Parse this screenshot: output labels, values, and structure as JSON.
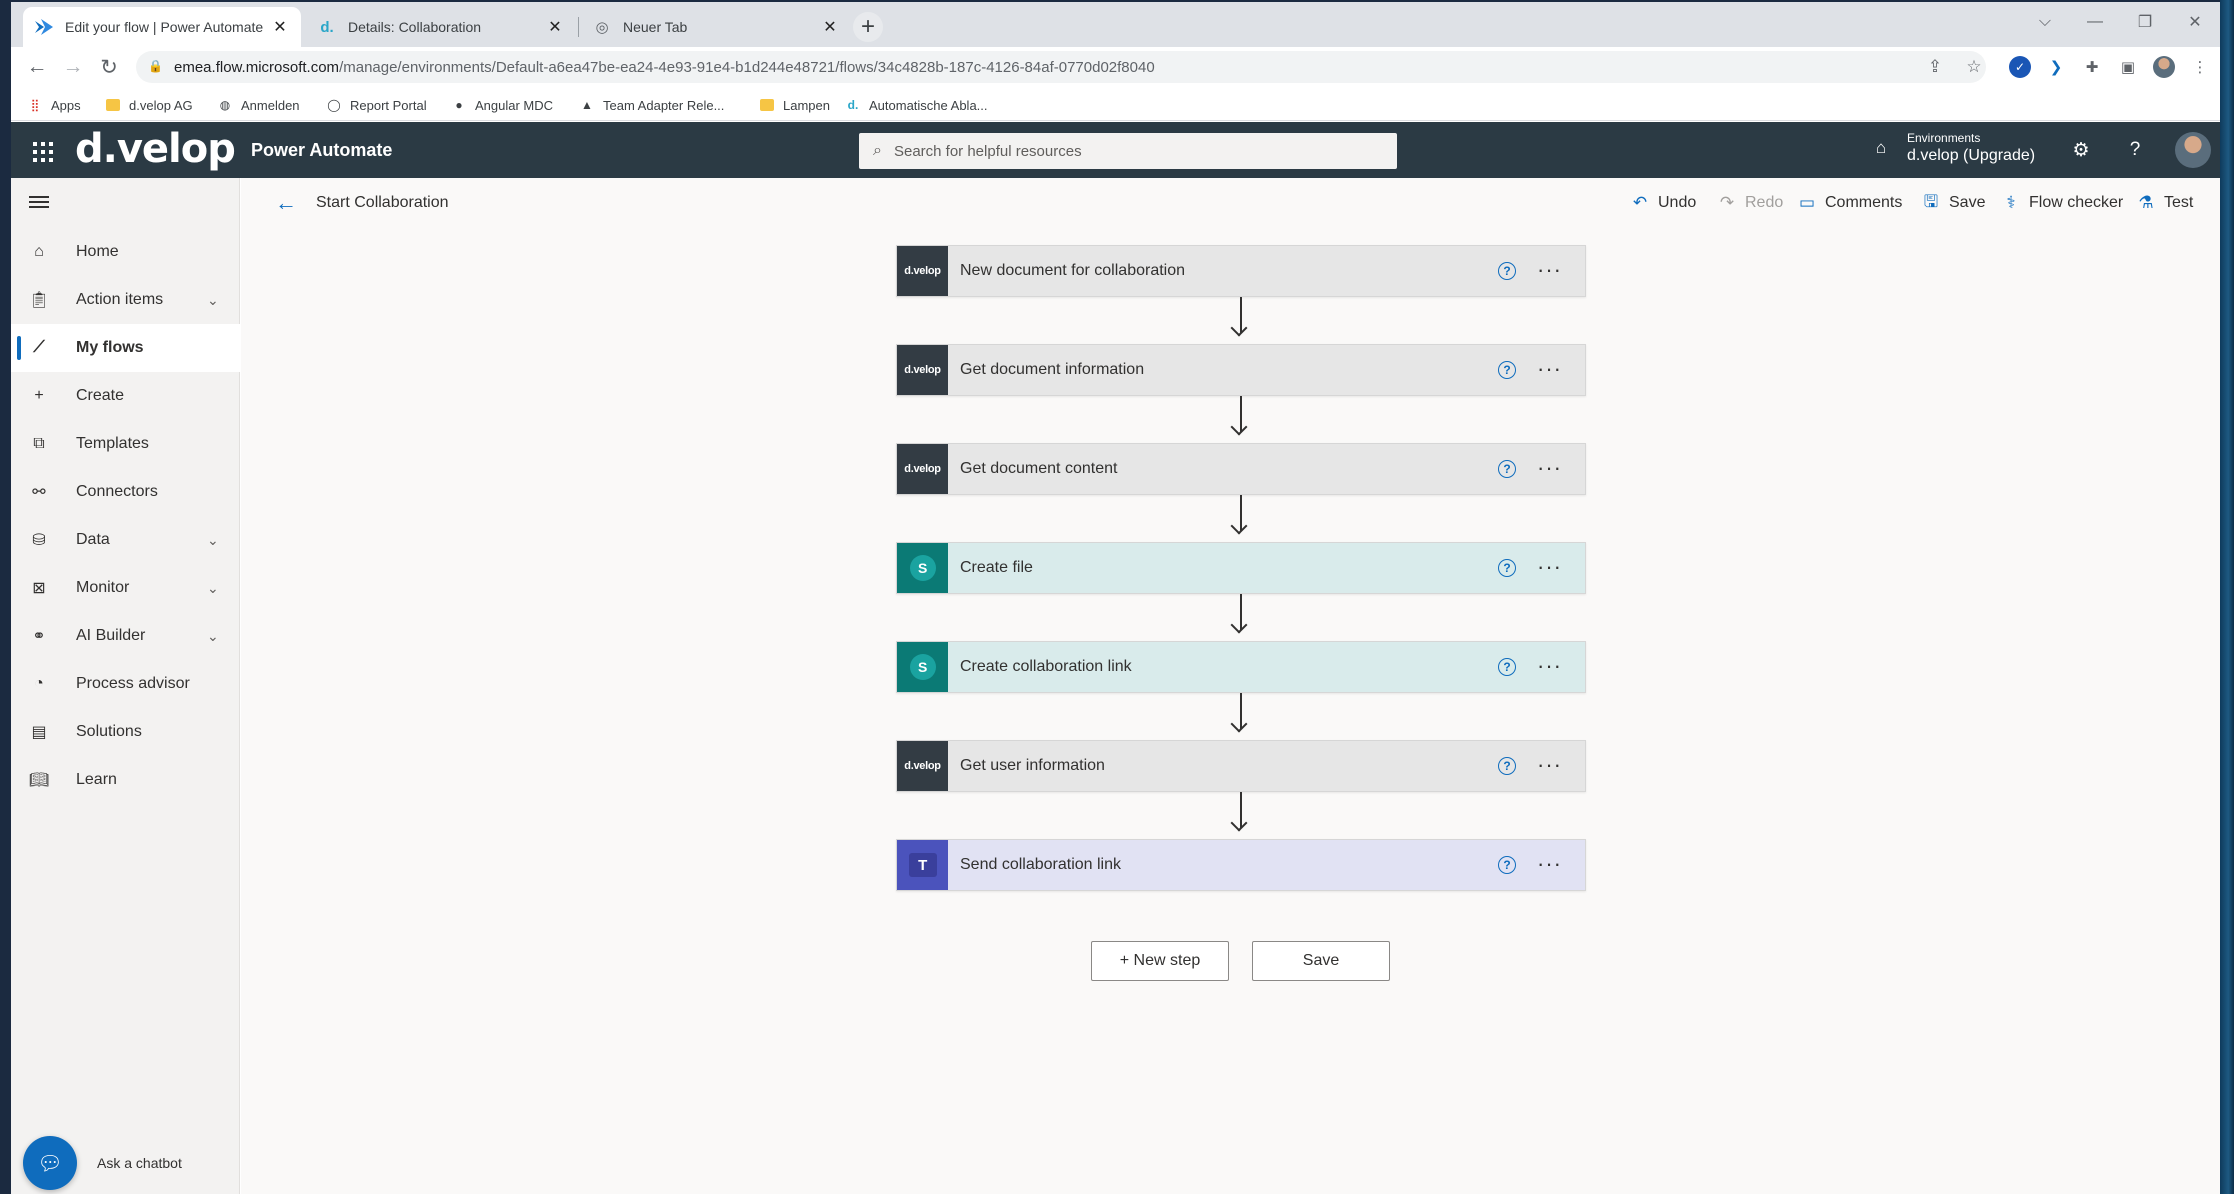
{
  "browser": {
    "tabs": [
      {
        "label": "Edit your flow | Power Automate",
        "icon": "power-automate-icon"
      },
      {
        "label": "Details: Collaboration",
        "icon": "dvelop-d-icon"
      },
      {
        "label": "Neuer Tab",
        "icon": "chrome-icon"
      }
    ],
    "url_host": "emea.flow.microsoft.com",
    "url_path": "/manage/environments/Default-a6ea47be-ea24-4e93-91e4-b1d244e48721/flows/34c4828b-187c-4126-84af-0770d02f8040",
    "bookmarks": [
      {
        "label": "Apps",
        "icon": "apps-grid-icon"
      },
      {
        "label": "d.velop AG",
        "icon": "folder-icon"
      },
      {
        "label": "Anmelden",
        "icon": "globe-icon"
      },
      {
        "label": "Report Portal",
        "icon": "circle-icon"
      },
      {
        "label": "Angular MDC",
        "icon": "github-icon"
      },
      {
        "label": "Team Adapter Rele...",
        "icon": "angular-icon"
      },
      {
        "label": "Lampen",
        "icon": "folder-icon"
      },
      {
        "label": "Automatische Abla...",
        "icon": "dvelop-d-icon"
      }
    ]
  },
  "header": {
    "brand": "d.velop",
    "product": "Power Automate",
    "search_placeholder": "Search for helpful resources",
    "env_title": "Environments",
    "env_name": "d.velop (Upgrade)"
  },
  "sidebar": {
    "items": [
      {
        "label": "Home",
        "icon": "home-icon"
      },
      {
        "label": "Action items",
        "icon": "clipboard-icon",
        "expandable": true
      },
      {
        "label": "My flows",
        "icon": "flow-icon",
        "active": true
      },
      {
        "label": "Create",
        "icon": "plus-icon"
      },
      {
        "label": "Templates",
        "icon": "templates-icon"
      },
      {
        "label": "Connectors",
        "icon": "connector-icon"
      },
      {
        "label": "Data",
        "icon": "database-icon",
        "expandable": true
      },
      {
        "label": "Monitor",
        "icon": "monitor-icon",
        "expandable": true
      },
      {
        "label": "AI Builder",
        "icon": "ai-builder-icon",
        "expandable": true
      },
      {
        "label": "Process advisor",
        "icon": "process-advisor-icon"
      },
      {
        "label": "Solutions",
        "icon": "solutions-icon"
      },
      {
        "label": "Learn",
        "icon": "book-icon"
      }
    ],
    "chatbot_label": "Ask a chatbot"
  },
  "commandbar": {
    "flow_name": "Start Collaboration",
    "undo": "Undo",
    "redo": "Redo",
    "comments": "Comments",
    "save": "Save",
    "flow_checker": "Flow checker",
    "test": "Test"
  },
  "steps": [
    {
      "title": "New document for collaboration",
      "connector": "d.velop"
    },
    {
      "title": "Get document information",
      "connector": "d.velop"
    },
    {
      "title": "Get document content",
      "connector": "d.velop"
    },
    {
      "title": "Create file",
      "connector": "SharePoint"
    },
    {
      "title": "Create collaboration link",
      "connector": "SharePoint"
    },
    {
      "title": "Get user information",
      "connector": "d.velop"
    },
    {
      "title": "Send collaboration link",
      "connector": "Teams"
    }
  ],
  "logo_text": "d.velop",
  "actions": {
    "new_step": "+ New step",
    "save": "Save"
  },
  "colors": {
    "header": "#2b3a44",
    "accent": "#0f6cbd",
    "dvelop_card": "#e6e6e6",
    "sharepoint_card": "#d9ebeb",
    "teams_card": "#e1e2f3"
  }
}
